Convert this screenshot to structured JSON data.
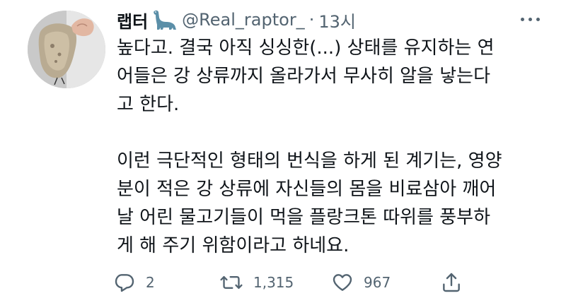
{
  "tweet": {
    "name": "랩터",
    "handle": "@Real_raptor_",
    "separator": "·",
    "time": "13시",
    "lines_para1": [
      "높다고. 결국 아직 싱싱한(...) 상태를 유지하는 연",
      "어들은 강 상류까지 올라가서 무사히 알을 낳는다",
      "고 한다."
    ],
    "lines_para2": [
      "이런 극단적인 형태의 번식을 하게 된 계기는, 영양",
      "분이 적은 강 상류에 자신들의 몸을 비료삼아 깨어",
      "날 어린 물고기들이 먹을 플랑크톤 따위를 풍부하",
      "게 해 주기 위함이라고 하네요."
    ]
  },
  "actions": {
    "replies": "2",
    "retweets": "1,315",
    "likes": "967"
  },
  "icons": {
    "verified_emoji": "sauropod-icon",
    "reply": "reply-icon",
    "retweet": "retweet-icon",
    "like": "heart-icon",
    "share": "share-icon",
    "more": "more-icon"
  },
  "colors": {
    "text": "#0f1419",
    "muted": "#536471",
    "dino": "#5b8fa8"
  }
}
